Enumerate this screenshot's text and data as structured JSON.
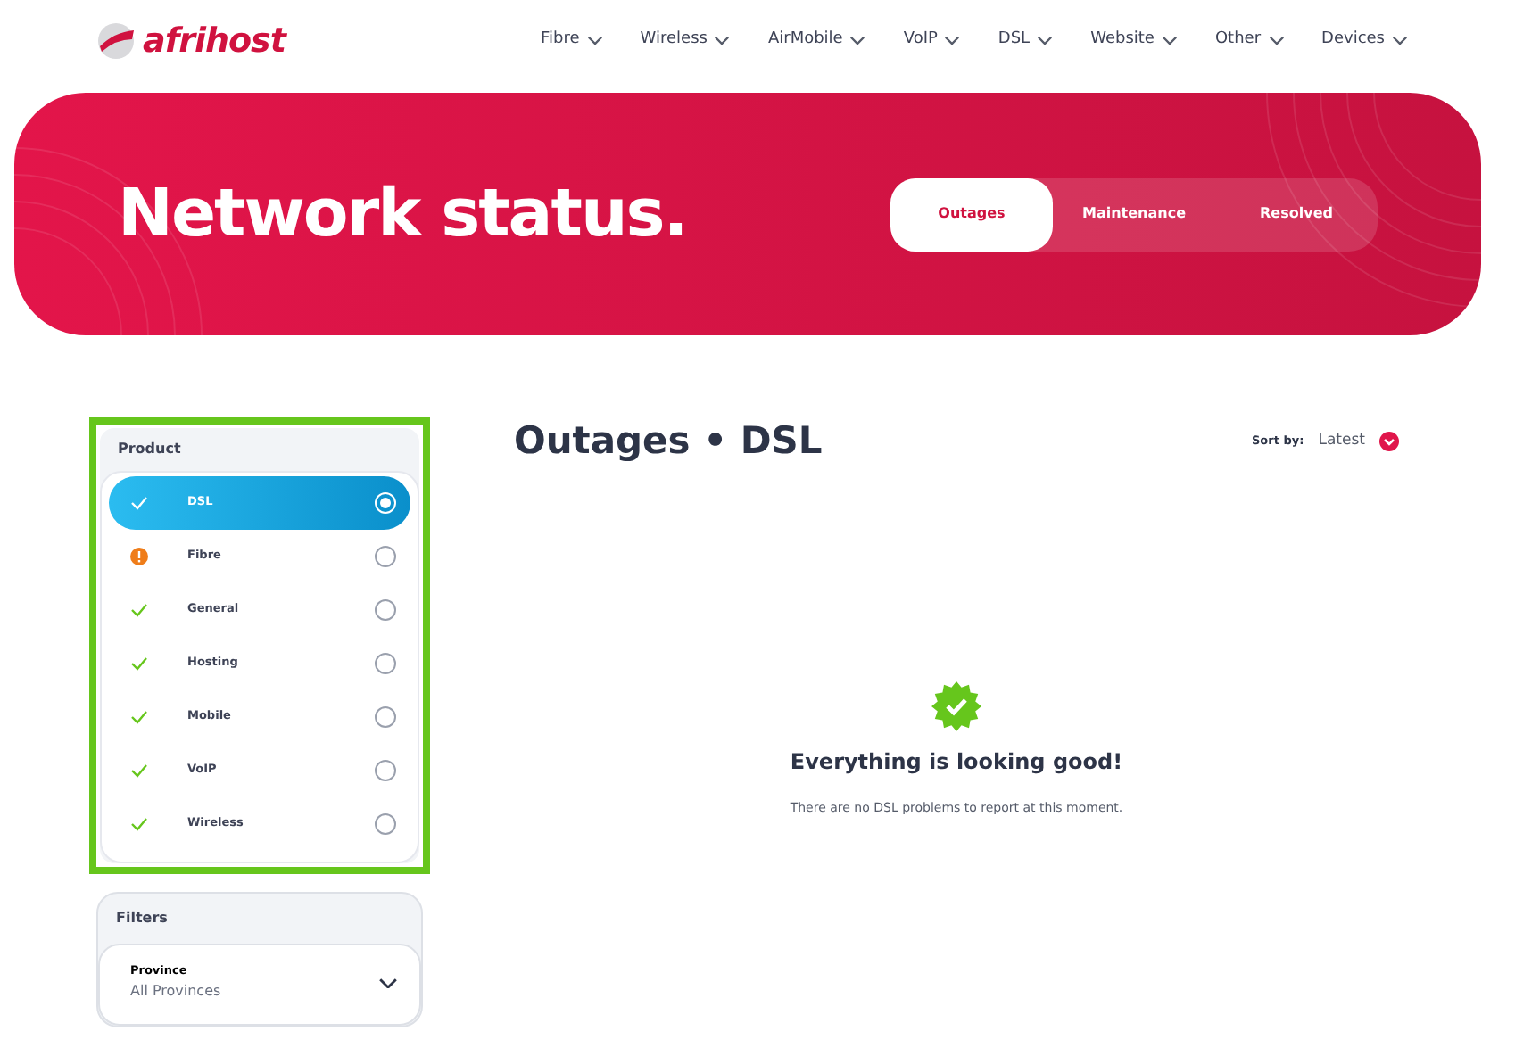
{
  "logo": {
    "text": "afrihost"
  },
  "nav": [
    {
      "label": "Fibre"
    },
    {
      "label": "Wireless"
    },
    {
      "label": "AirMobile"
    },
    {
      "label": "VoIP"
    },
    {
      "label": "DSL"
    },
    {
      "label": "Website"
    },
    {
      "label": "Other"
    },
    {
      "label": "Devices"
    }
  ],
  "hero": {
    "title": "Network status.",
    "tabs": [
      {
        "label": "Outages",
        "selected": true
      },
      {
        "label": "Maintenance",
        "selected": false
      },
      {
        "label": "Resolved",
        "selected": false
      }
    ]
  },
  "product_panel": {
    "title": "Product",
    "items": [
      {
        "label": "DSL",
        "kind": "ok",
        "selected": true
      },
      {
        "label": "Fibre",
        "kind": "warning",
        "selected": false
      },
      {
        "label": "General",
        "kind": "ok",
        "selected": false
      },
      {
        "label": "Hosting",
        "kind": "ok",
        "selected": false
      },
      {
        "label": "Mobile",
        "kind": "ok",
        "selected": false
      },
      {
        "label": "VoIP",
        "kind": "ok",
        "selected": false
      },
      {
        "label": "Wireless",
        "kind": "ok",
        "selected": false
      }
    ]
  },
  "filters": {
    "title": "Filters",
    "province": {
      "label": "Province",
      "value": "All Provinces"
    }
  },
  "main": {
    "heading": "Outages • DSL",
    "sort": {
      "label": "Sort by:",
      "value": "Latest"
    },
    "empty": {
      "title": "Everything is looking good!",
      "message": "There are no DSL problems to report at this moment."
    }
  }
}
